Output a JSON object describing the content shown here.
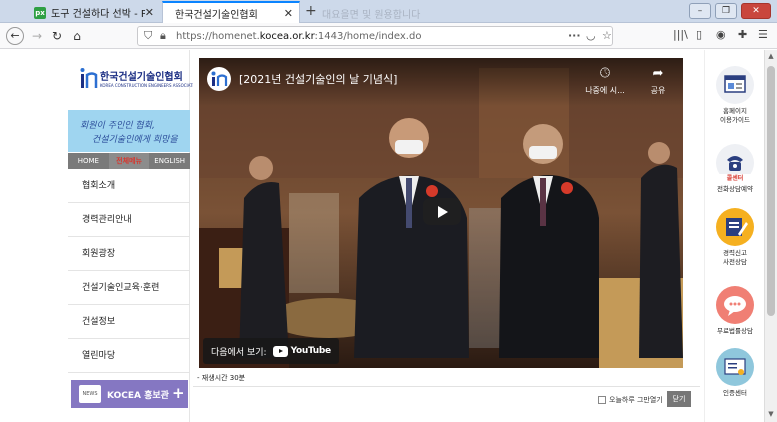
{
  "browser": {
    "tabs": [
      {
        "title": "도구 건설하다 선박 - Pixabay의",
        "favicon": "px"
      },
      {
        "title": "한국건설기술인협회"
      }
    ],
    "new_tab_ghost": "대요을면 및 원용합니다",
    "url_prefix": "https://homenet.",
    "url_domain": "kocea.or.kr",
    "url_suffix": ":1443/home/index.do"
  },
  "site": {
    "logo_name": "한국건설기술인협회",
    "logo_sub": "KOREA CONSTRUCTION ENGINEERS ASSOCIATION",
    "banner_line1": "회원이 주인인 협회,",
    "banner_line2": "건설기술인에게 희망을",
    "top_links": [
      "HOME",
      "전체메뉴",
      "ENGLISH"
    ],
    "menu": [
      "협회소개",
      "경력관리안내",
      "회원광장",
      "건설기술인교육·훈련",
      "건설정보",
      "열린마당"
    ],
    "promo_icon": "NEWS",
    "promo_label": "KOCEA 홍보관",
    "promo_plus": "+"
  },
  "video": {
    "title": "[2021년 건설기술인의 날 기념식]",
    "watch_later": "나중에 시...",
    "share": "공유",
    "watch_on": "다음에서 보기:",
    "youtube": "YouTube",
    "runtime": "- 재생시간 30분"
  },
  "modal": {
    "dont_show_today": "오늘하루 그만열기",
    "close": "닫기"
  },
  "quick_links": [
    {
      "label1": "홈페이지",
      "label2": "이용가이드",
      "color": "#eef0f4"
    },
    {
      "badge": "콜센터",
      "label1": "전화상담예약",
      "label2": "",
      "color": "#eef0f4"
    },
    {
      "label1": "경력신고",
      "label2": "사전상담",
      "color": "#f5b020"
    },
    {
      "label1": "무료법률상담",
      "label2": "",
      "color": "#f07f74"
    },
    {
      "label1": "인증센터",
      "label2": "",
      "color": "#8fc7dc"
    }
  ],
  "colors": {
    "brand_blue": "#1c2f84",
    "accent_red": "#d6382f",
    "promo_purple": "#8577c2",
    "tab_accent": "#0a84ff"
  }
}
